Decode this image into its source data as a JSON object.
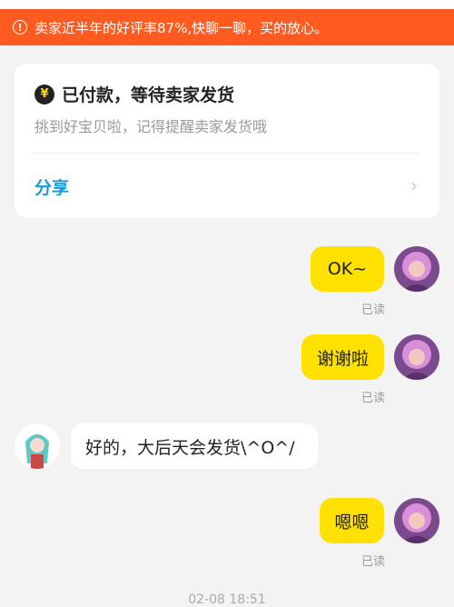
{
  "banner": {
    "text": "卖家近半年的好评率87%,快聊一聊，买的放心。"
  },
  "order_card": {
    "coin_symbol": "¥",
    "title": "已付款，等待卖家发货",
    "subtitle": "挑到好宝贝啦，记得提醒卖家发货哦",
    "share_label": "分享",
    "chevron": "›"
  },
  "messages": [
    {
      "text": "OK~",
      "read": "已读"
    },
    {
      "text": "谢谢啦",
      "read": "已读"
    },
    {
      "text": "好的，大后天会发货\\^O^/"
    },
    {
      "text": "嗯嗯",
      "read": "已读"
    }
  ],
  "timestamp": "02-08 18:51",
  "colors": {
    "banner": "#ff5a1f",
    "bubble_me": "#ffe100",
    "share": "#1a9bd7"
  }
}
